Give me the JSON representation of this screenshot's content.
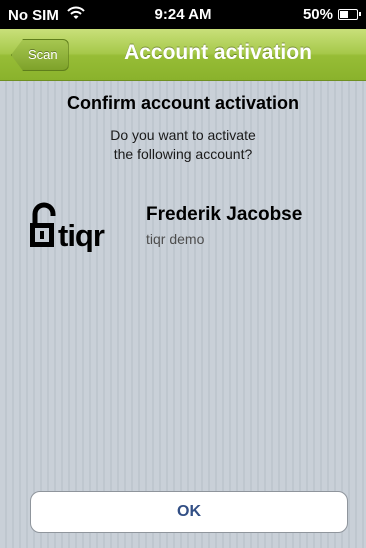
{
  "status_bar": {
    "carrier": "No SIM",
    "time": "9:24 AM",
    "battery_percent": "50%",
    "battery_level": 0.5,
    "wifi_icon": "wifi-icon",
    "battery_icon": "battery-charging-icon"
  },
  "nav_bar": {
    "back_label": "Scan",
    "title": "Account activation",
    "accent_color": "#97bd36"
  },
  "content": {
    "heading": "Confirm account activation",
    "message_line1": "Do you want to activate",
    "message_line2": "the following account?"
  },
  "account": {
    "logo_text": "tiqr",
    "logo_icon": "padlock-open-icon",
    "name": "Frederik Jacobse",
    "issuer": "tiqr demo"
  },
  "actions": {
    "ok_label": "OK"
  }
}
